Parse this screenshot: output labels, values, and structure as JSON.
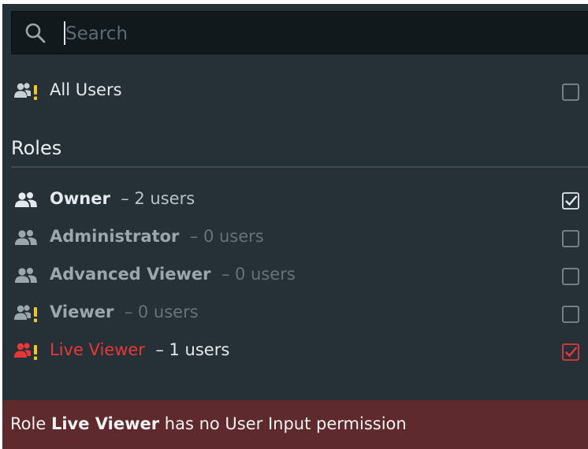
{
  "search": {
    "placeholder": "Search"
  },
  "all_users": {
    "label": "All Users",
    "checked": false
  },
  "roles_section": {
    "title": "Roles",
    "items": [
      {
        "label": "Owner",
        "separator": "–",
        "count": "2 users",
        "checked": true,
        "icon": "users-icon",
        "state": "normal"
      },
      {
        "label": "Administrator",
        "separator": "–",
        "count": "0 users",
        "checked": false,
        "icon": "users-icon",
        "state": "inactive"
      },
      {
        "label": "Advanced Viewer",
        "separator": "–",
        "count": "0 users",
        "checked": false,
        "icon": "users-icon",
        "state": "inactive"
      },
      {
        "label": "Viewer",
        "separator": "–",
        "count": "0 users",
        "checked": false,
        "icon": "users-warning-icon",
        "state": "inactive"
      },
      {
        "label": "Live Viewer",
        "separator": "–",
        "count": "1 users",
        "checked": true,
        "icon": "users-warning-icon",
        "state": "alert"
      }
    ]
  },
  "footer": {
    "prefix": "Role",
    "role_name": "Live Viewer",
    "suffix": "has no User Input permission"
  },
  "colors": {
    "panel_bg": "#263137",
    "search_bg": "#12191c",
    "alert_red": "#e8363a",
    "warning_yellow": "#f5c518",
    "footer_bg": "#5e2a2e"
  }
}
